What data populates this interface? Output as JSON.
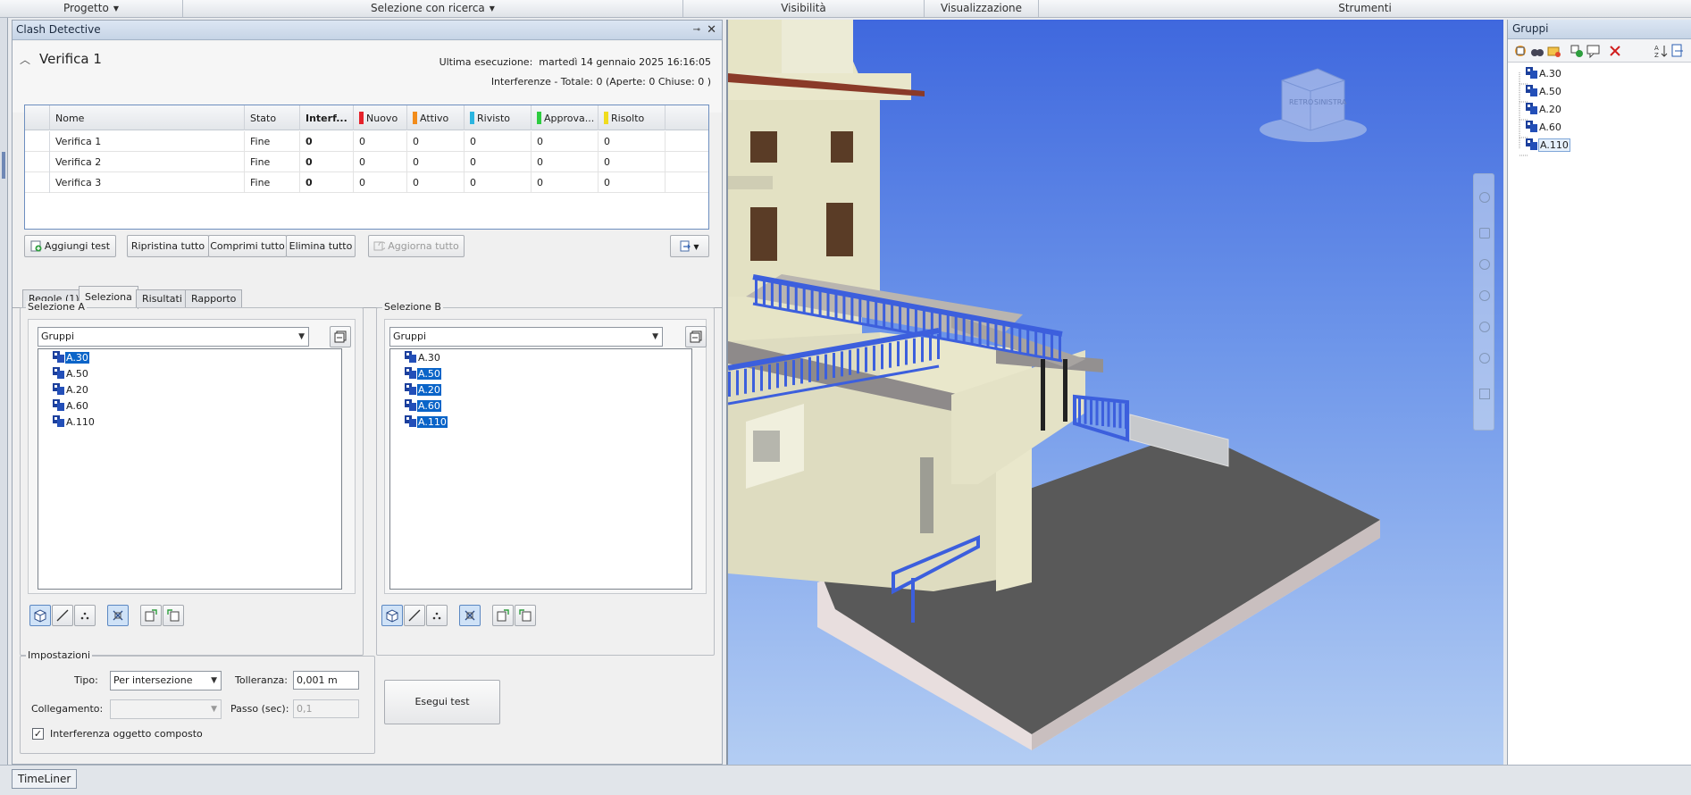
{
  "ribbon": [
    {
      "label": "Progetto",
      "caret": true
    },
    {
      "label": "Selezione con ricerca",
      "caret": true
    },
    {
      "label": "Visibilità",
      "caret": false
    },
    {
      "label": "Visualizzazione",
      "caret": false
    },
    {
      "label": "Strumenti",
      "caret": false
    }
  ],
  "panel": {
    "title": "Clash Detective",
    "test_name": "Verifica 1",
    "last_run_label": "Ultima esecuzione:",
    "last_run_value": "martedì 14 gennaio 2025 16:16:05",
    "summary": "Interferenze -  Totale:  0  (Aperte:  0  Chiuse:  0 )"
  },
  "table": {
    "columns": [
      "Nome",
      "Stato",
      "Interf...",
      "Nuovo",
      "Attivo",
      "Rivisto",
      "Approva...",
      "Risolto"
    ],
    "status_colors": {
      "Nuovo": "#e5222b",
      "Attivo": "#f28c1b",
      "Rivisto": "#2bb5e0",
      "Approva...": "#2ecc40",
      "Risolto": "#f0dc1e"
    },
    "rows": [
      [
        "Verifica 1",
        "Fine",
        "0",
        "0",
        "0",
        "0",
        "0",
        "0"
      ],
      [
        "Verifica 2",
        "Fine",
        "0",
        "0",
        "0",
        "0",
        "0",
        "0"
      ],
      [
        "Verifica 3",
        "Fine",
        "0",
        "0",
        "0",
        "0",
        "0",
        "0"
      ]
    ]
  },
  "buttons": {
    "add_test": "Aggiungi test",
    "reset_all": "Ripristina tutto",
    "compact_all": "Comprimi tutto",
    "delete_all": "Elimina tutto",
    "update_all": "Aggiorna tutto"
  },
  "tabs": [
    "Regole (1)",
    "Seleziona",
    "Risultati",
    "Rapporto"
  ],
  "selection_a": {
    "title": "Selezione A",
    "combo_value": "Gruppi",
    "items": [
      "A.30",
      "A.50",
      "A.20",
      "A.60",
      "A.110"
    ],
    "selected": [
      true,
      false,
      false,
      false,
      false
    ]
  },
  "selection_b": {
    "title": "Selezione B",
    "combo_value": "Gruppi",
    "items": [
      "A.30",
      "A.50",
      "A.20",
      "A.60",
      "A.110"
    ],
    "selected": [
      false,
      true,
      true,
      true,
      true
    ]
  },
  "settings": {
    "title": "Impostazioni",
    "type_label": "Tipo:",
    "type_value": "Per intersezione",
    "tolerance_label": "Tolleranza:",
    "tolerance_value": "0,001 m",
    "link_label": "Collegamento:",
    "link_value": "",
    "step_label": "Passo (sec):",
    "step_value": "0,1",
    "composite_label": "Interferenza oggetto composto",
    "composite_checked": true,
    "run_button": "Esegui test"
  },
  "viewcube": {
    "left": "RETRO",
    "right": "SINISTRA"
  },
  "groups_panel": {
    "title": "Gruppi",
    "items": [
      "A.30",
      "A.50",
      "A.20",
      "A.60",
      "A.110"
    ]
  },
  "bottom": {
    "tab": "TimeLiner"
  }
}
